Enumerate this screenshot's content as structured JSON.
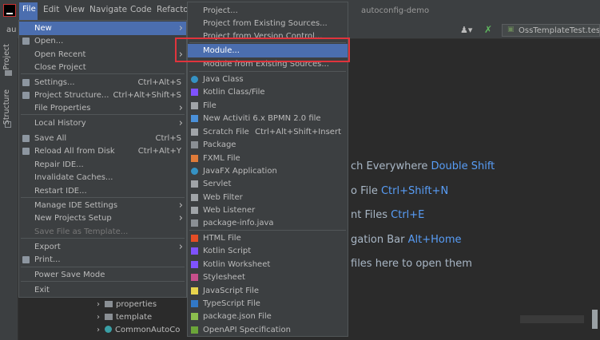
{
  "menubar": {
    "file": "File",
    "edit": "Edit",
    "view": "View",
    "navigate": "Navigate",
    "code": "Code",
    "refactor": "Refactor"
  },
  "window_title": "autoconfig-demo",
  "breadcrumb": "au",
  "run_config": "OssTemplateTest.testU",
  "tool_windows": {
    "project": "Project",
    "structure": "Structure"
  },
  "file_menu": {
    "items": [
      {
        "label": "New",
        "shortcut": "",
        "submenu": true,
        "selected": true
      },
      {
        "label": "Open...",
        "shortcut": "",
        "submenu": false
      },
      {
        "label": "Open Recent",
        "shortcut": "",
        "submenu": true
      },
      {
        "label": "Close Project",
        "shortcut": "",
        "submenu": false
      },
      {
        "label": "Settings...",
        "shortcut": "Ctrl+Alt+S",
        "submenu": false
      },
      {
        "label": "Project Structure...",
        "shortcut": "Ctrl+Alt+Shift+S",
        "submenu": false
      },
      {
        "label": "File Properties",
        "shortcut": "",
        "submenu": true
      },
      {
        "label": "Local History",
        "shortcut": "",
        "submenu": true
      },
      {
        "label": "Save All",
        "shortcut": "Ctrl+S",
        "submenu": false
      },
      {
        "label": "Reload All from Disk",
        "shortcut": "Ctrl+Alt+Y",
        "submenu": false
      },
      {
        "label": "Repair IDE...",
        "shortcut": "",
        "submenu": false
      },
      {
        "label": "Invalidate Caches...",
        "shortcut": "",
        "submenu": false
      },
      {
        "label": "Restart IDE...",
        "shortcut": "",
        "submenu": false
      },
      {
        "label": "Manage IDE Settings",
        "shortcut": "",
        "submenu": true
      },
      {
        "label": "New Projects Setup",
        "shortcut": "",
        "submenu": true
      },
      {
        "label": "Save File as Template...",
        "shortcut": "",
        "submenu": false,
        "disabled": true
      },
      {
        "label": "Export",
        "shortcut": "",
        "submenu": true
      },
      {
        "label": "Print...",
        "shortcut": "",
        "submenu": false
      },
      {
        "label": "Power Save Mode",
        "shortcut": "",
        "submenu": false
      },
      {
        "label": "Exit",
        "shortcut": "",
        "submenu": false
      }
    ]
  },
  "new_menu": {
    "items": [
      {
        "label": "Project...",
        "shortcut": ""
      },
      {
        "label": "Project from Existing Sources...",
        "shortcut": ""
      },
      {
        "label": "Project from Version Control...",
        "shortcut": ""
      },
      {
        "label": "Module...",
        "shortcut": "",
        "selected": true
      },
      {
        "label": "Module from Existing Sources...",
        "shortcut": ""
      },
      {
        "label": "Java Class",
        "shortcut": ""
      },
      {
        "label": "Kotlin Class/File",
        "shortcut": ""
      },
      {
        "label": "File",
        "shortcut": ""
      },
      {
        "label": "New Activiti 6.x BPMN 2.0 file",
        "shortcut": ""
      },
      {
        "label": "Scratch File",
        "shortcut": "Ctrl+Alt+Shift+Insert"
      },
      {
        "label": "Package",
        "shortcut": ""
      },
      {
        "label": "FXML File",
        "shortcut": ""
      },
      {
        "label": "JavaFX Application",
        "shortcut": ""
      },
      {
        "label": "Servlet",
        "shortcut": ""
      },
      {
        "label": "Web Filter",
        "shortcut": ""
      },
      {
        "label": "Web Listener",
        "shortcut": ""
      },
      {
        "label": "package-info.java",
        "shortcut": ""
      },
      {
        "label": "HTML File",
        "shortcut": ""
      },
      {
        "label": "Kotlin Script",
        "shortcut": ""
      },
      {
        "label": "Kotlin Worksheet",
        "shortcut": ""
      },
      {
        "label": "Stylesheet",
        "shortcut": ""
      },
      {
        "label": "JavaScript File",
        "shortcut": ""
      },
      {
        "label": "TypeScript File",
        "shortcut": ""
      },
      {
        "label": "package.json File",
        "shortcut": ""
      },
      {
        "label": "OpenAPI Specification",
        "shortcut": ""
      }
    ]
  },
  "editor_hints": [
    {
      "text": "ch Everywhere",
      "key": "Double Shift"
    },
    {
      "text": "o File",
      "key": "Ctrl+Shift+N"
    },
    {
      "text": "nt Files",
      "key": "Ctrl+E"
    },
    {
      "text": "gation Bar",
      "key": "Alt+Home"
    },
    {
      "text": "files here to open them",
      "key": ""
    }
  ],
  "project_tree": [
    {
      "label": "properties"
    },
    {
      "label": "template"
    },
    {
      "label": "CommonAutoCo"
    }
  ],
  "colors": {
    "selection": "#4b6eaf",
    "highlight_box": "#e0343c",
    "shortcut_text": "#589df6"
  }
}
